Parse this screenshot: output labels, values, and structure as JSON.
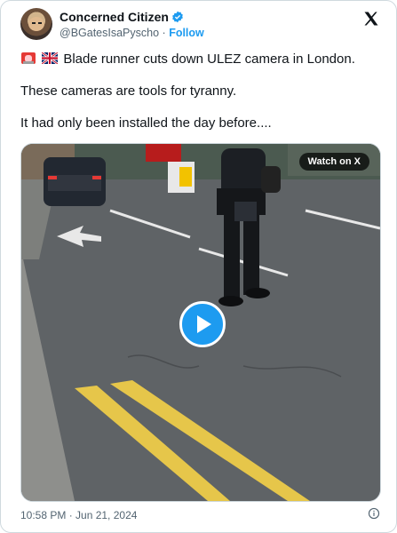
{
  "author": {
    "name": "Concerned Citizen",
    "handle": "@BGatesIsaPyscho",
    "separator": "·",
    "follow_label": "Follow",
    "verified": true
  },
  "icons": {
    "platform_logo": "x-logo-icon",
    "verified": "verified-badge-icon",
    "info": "info-icon",
    "play": "play-icon"
  },
  "tweet": {
    "line1": "Blade runner cuts down ULEZ camera in London.",
    "line2": "These cameras are tools for tyranny.",
    "line3": "It had only been installed the day before....",
    "emojis": [
      "rotating-light-emoji",
      "uk-flag-emoji"
    ]
  },
  "media": {
    "watch_label": "Watch on X"
  },
  "meta": {
    "timestamp": "10:58 PM · Jun 21, 2024"
  },
  "colors": {
    "accent": "#1d9bf0",
    "text": "#0f1419",
    "muted": "#536471"
  }
}
